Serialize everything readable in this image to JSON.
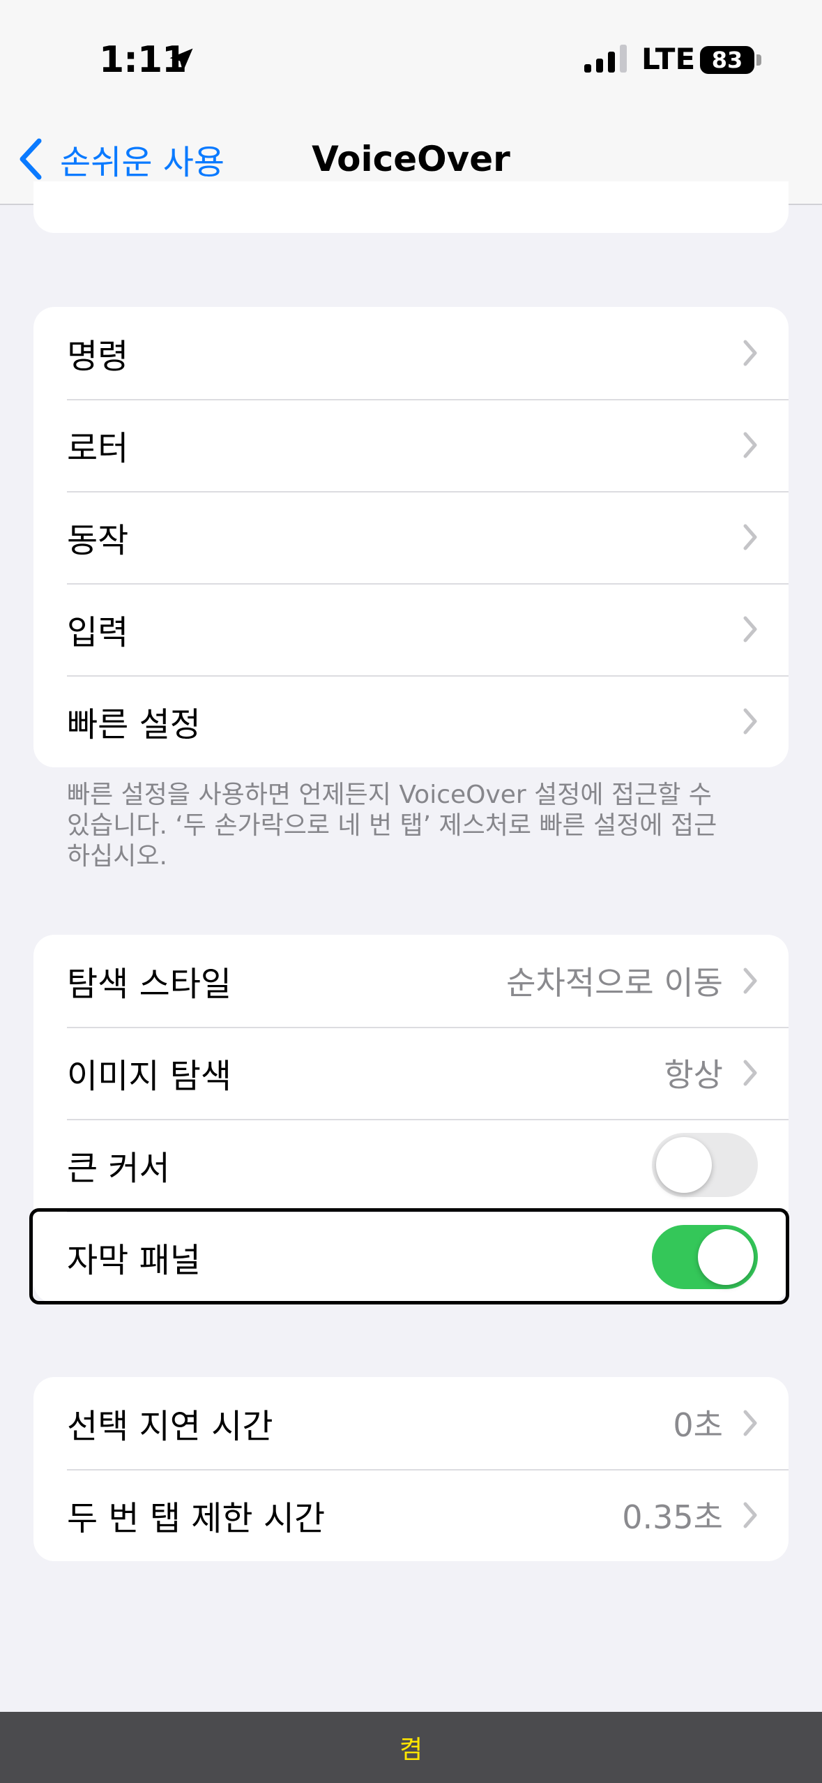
{
  "status_bar": {
    "time": "1:11",
    "network": "LTE",
    "battery": "83",
    "icons": [
      "location-arrow-icon",
      "signal-bars-icon",
      "battery-icon"
    ]
  },
  "nav": {
    "back_label": "손쉬운 사용",
    "title": "VoiceOver"
  },
  "group1": {
    "items": [
      {
        "label": "명령"
      },
      {
        "label": "로터"
      },
      {
        "label": "동작"
      },
      {
        "label": "입력"
      },
      {
        "label": "빠른 설정"
      }
    ],
    "footer": "빠른 설정을 사용하면 언제든지 VoiceOver 설정에 접근할 수 있습니다. ‘두 손가락으로 네 번 탭’ 제스처로 빠른 설정에 접근하십시오."
  },
  "group2": {
    "items": [
      {
        "label": "탐색 스타일",
        "value": "순차적으로 이동"
      },
      {
        "label": "이미지 탐색",
        "value": "항상"
      },
      {
        "label": "큰 커서",
        "toggle": false
      },
      {
        "label": "자막 패널",
        "toggle": true
      }
    ]
  },
  "group3": {
    "items": [
      {
        "label": "선택 지연 시간",
        "value": "0초"
      },
      {
        "label": "두 번 탭 제한 시간",
        "value": "0.35초"
      }
    ]
  },
  "caption_panel": {
    "text": "켬"
  },
  "colors": {
    "accent": "#0a7aff",
    "toggle_on": "#34c759",
    "background": "#f2f2f7",
    "caption_text": "#ffe600"
  }
}
